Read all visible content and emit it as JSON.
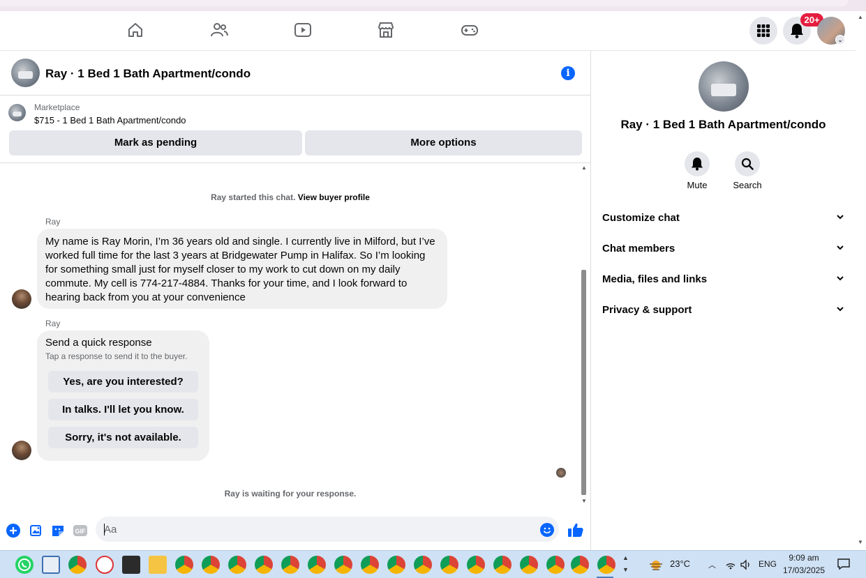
{
  "nav": {
    "icons": [
      "home-icon",
      "friends-icon",
      "video-icon",
      "marketplace-icon",
      "gaming-icon"
    ],
    "notification_count": "20+"
  },
  "chat": {
    "header_title": "Ray · 1 Bed 1 Bath Apartment/condo",
    "listing": {
      "kicker": "Marketplace",
      "price_title": "$715 - 1 Bed 1 Bath Apartment/condo",
      "mark_pending_label": "Mark as pending",
      "more_options_label": "More options"
    },
    "started_prefix": "Ray started this chat.",
    "view_profile_link": "View buyer profile",
    "messages": [
      {
        "sender": "Ray",
        "text": "My name is Ray Morin, I’m 36 years old and single. I currently live in Milford, but I’ve worked full time for the last 3 years at Bridgewater Pump in Halifax. So I’m looking for something small just for myself closer to my work to cut down on my daily commute. My cell is 774-217-4884. Thanks for your time, and I look forward to hearing back from you at your convenience"
      },
      {
        "sender": "Ray",
        "quick_title": "Send a quick response",
        "quick_sub": "Tap a response to send it to the buyer.",
        "options": [
          "Yes, are you interested?",
          "In talks. I'll let you know.",
          "Sorry, it's not available."
        ]
      }
    ],
    "waiting_text": "Ray is waiting for your response.",
    "composer": {
      "placeholder": "Aa",
      "gif_label": "GIF"
    }
  },
  "side": {
    "title": "Ray · 1 Bed 1 Bath Apartment/condo",
    "actions": [
      {
        "label": "Mute",
        "icon": "bell-icon"
      },
      {
        "label": "Search",
        "icon": "search-icon"
      }
    ],
    "sections": [
      "Customize chat",
      "Chat members",
      "Media, files and links",
      "Privacy & support"
    ]
  },
  "taskbar": {
    "weather": "23°C",
    "language": "ENG",
    "time": "9:09 am",
    "date": "17/03/2025"
  },
  "colors": {
    "accent": "#0866ff",
    "badge": "#e41e3f",
    "bubble": "#f0f0f0",
    "button_gray": "#e4e6eb"
  }
}
